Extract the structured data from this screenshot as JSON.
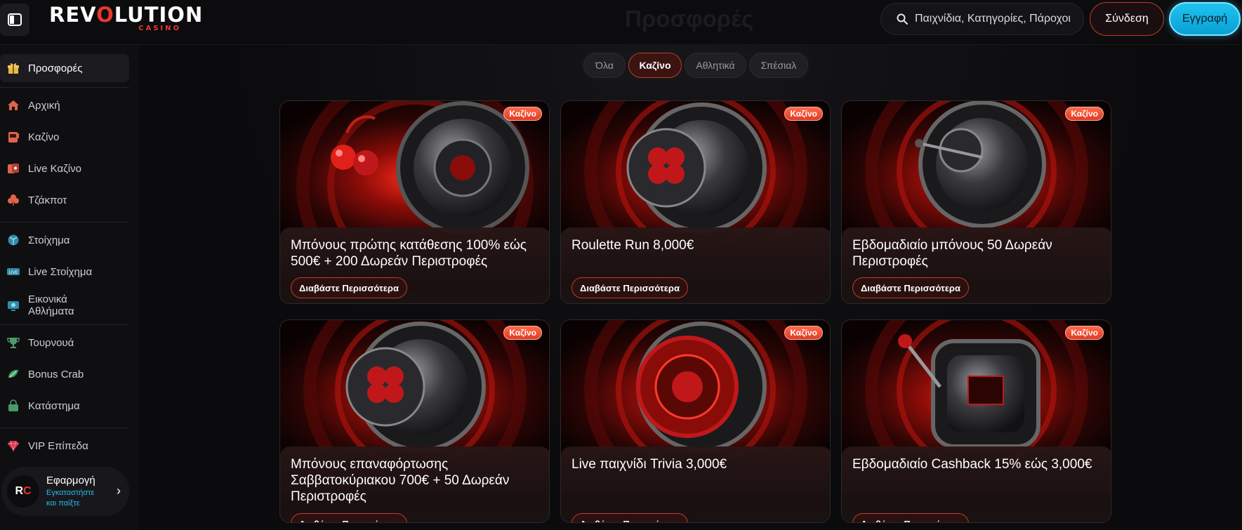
{
  "header": {
    "logo_main_a": "REV",
    "logo_main_o": "O",
    "logo_main_b": "LUTION",
    "logo_sub": "CASINO",
    "page_title": "Προσφορές",
    "search_placeholder": "Παιχνίδια, Κατηγορίες, Πάροχοι",
    "login_label": "Σύνδεση",
    "register_label": "Εγγραφή"
  },
  "sidebar": {
    "items": [
      {
        "label": "Προσφορές",
        "icon": "gift-icon",
        "active": true
      },
      {
        "label": "Αρχική",
        "icon": "home-icon"
      },
      {
        "label": "Καζίνο",
        "icon": "slot-machine-icon"
      },
      {
        "label": "Live Καζίνο",
        "icon": "live-cards-icon"
      },
      {
        "label": "Τζάκποτ",
        "icon": "jackpot-clover-icon"
      },
      {
        "label": "Στοίχημα",
        "icon": "sports-ball-icon"
      },
      {
        "label": "Live Στοίχημα",
        "icon": "live-badge-icon"
      },
      {
        "label": "Εικονικά Αθλήματα",
        "icon": "virtual-sports-icon"
      },
      {
        "label": "Τουρνουά",
        "icon": "trophy-icon"
      },
      {
        "label": "Bonus Crab",
        "icon": "bonus-crab-icon"
      },
      {
        "label": "Κατάστημα",
        "icon": "shop-icon"
      },
      {
        "label": "VIP Επίπεδα",
        "icon": "vip-diamond-icon"
      }
    ],
    "app": {
      "logo_a": "R",
      "logo_b": "C",
      "title": "Εφαρμογή",
      "subtitle": "Εγκαταστήστε και παίξτε"
    }
  },
  "tabs": [
    {
      "label": "Όλα",
      "active": false
    },
    {
      "label": "Καζίνο",
      "active": true
    },
    {
      "label": "Αθλητικά",
      "active": false
    },
    {
      "label": "Σπέσιαλ",
      "active": false
    }
  ],
  "cards": [
    {
      "badge": "Καζίνο",
      "title": "Μπόνους πρώτης κατάθεσης 100% εώς 500€ + 200 Δωρεάν Περιστροφές",
      "button": "Διαβάστε Περισσότερα",
      "art": "cherries-roulette"
    },
    {
      "badge": "Καζίνο",
      "title": "Roulette Run 8,000€",
      "button": "Διαβάστε Περισσότερα",
      "art": "clover-wheel"
    },
    {
      "badge": "Καζίνο",
      "title": "Εβδομαδιαίο μπόνους 50 Δωρεάν Περιστροφές",
      "button": "Διαβάστε Περισσότερα",
      "art": "vault-wheel"
    },
    {
      "badge": "Καζίνο",
      "title": "Μπόνους επαναφόρτωσης Σαββατοκύριακου 700€ + 50 Δωρεάν Περιστροφές",
      "button": "Διαβάστε Περισσότερα",
      "art": "clover-wheel"
    },
    {
      "badge": "Καζίνο",
      "title": "Live παιχνίδι Trivia 3,000€",
      "button": "Διαβάστε Περισσότερα",
      "art": "chip-wheel"
    },
    {
      "badge": "Καζίνο",
      "title": "Εβδομαδιαίο Cashback 15% εώς 3,000€",
      "button": "Διαβάστε Περισσότερα",
      "art": "slot-lever"
    }
  ],
  "colors": {
    "accent_red": "#e8372c",
    "accent_cyan": "#1fc3ef",
    "background": "#0b0b0d"
  }
}
